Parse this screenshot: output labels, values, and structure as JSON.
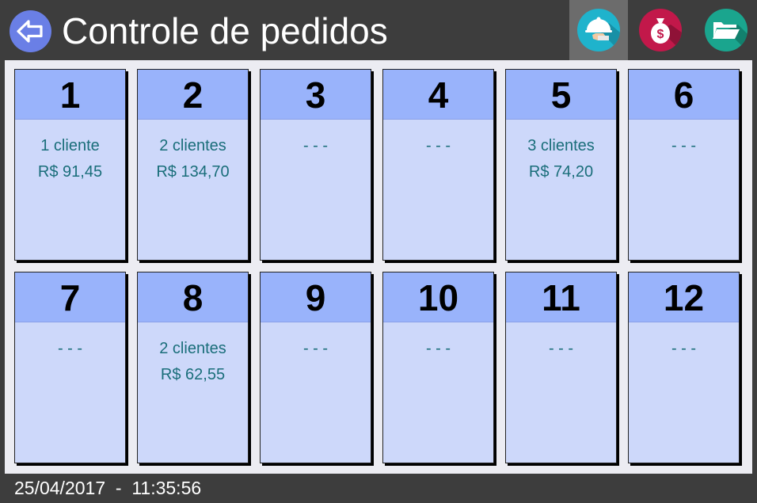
{
  "header": {
    "title": "Controle de pedidos",
    "buttons": [
      {
        "name": "waiter-tray-icon",
        "color": "#1fb3cc",
        "active": true
      },
      {
        "name": "money-bag-icon",
        "color": "#c2184a",
        "active": false
      },
      {
        "name": "folder-open-icon",
        "color": "#1aa58e",
        "active": false
      }
    ]
  },
  "tables": [
    {
      "number": "1",
      "clients": "1 cliente",
      "total": "R$ 91,45"
    },
    {
      "number": "2",
      "clients": "2 clientes",
      "total": "R$ 134,70"
    },
    {
      "number": "3",
      "clients": "- - -",
      "total": ""
    },
    {
      "number": "4",
      "clients": "- - -",
      "total": ""
    },
    {
      "number": "5",
      "clients": "3 clientes",
      "total": "R$ 74,20"
    },
    {
      "number": "6",
      "clients": "- - -",
      "total": ""
    },
    {
      "number": "7",
      "clients": "- - -",
      "total": ""
    },
    {
      "number": "8",
      "clients": "2 clientes",
      "total": "R$ 62,55"
    },
    {
      "number": "9",
      "clients": "- - -",
      "total": ""
    },
    {
      "number": "10",
      "clients": "- - -",
      "total": ""
    },
    {
      "number": "11",
      "clients": "- - -",
      "total": ""
    },
    {
      "number": "12",
      "clients": "- - -",
      "total": ""
    }
  ],
  "footer": {
    "datetime": "25/04/2017  -  11:35:56"
  }
}
